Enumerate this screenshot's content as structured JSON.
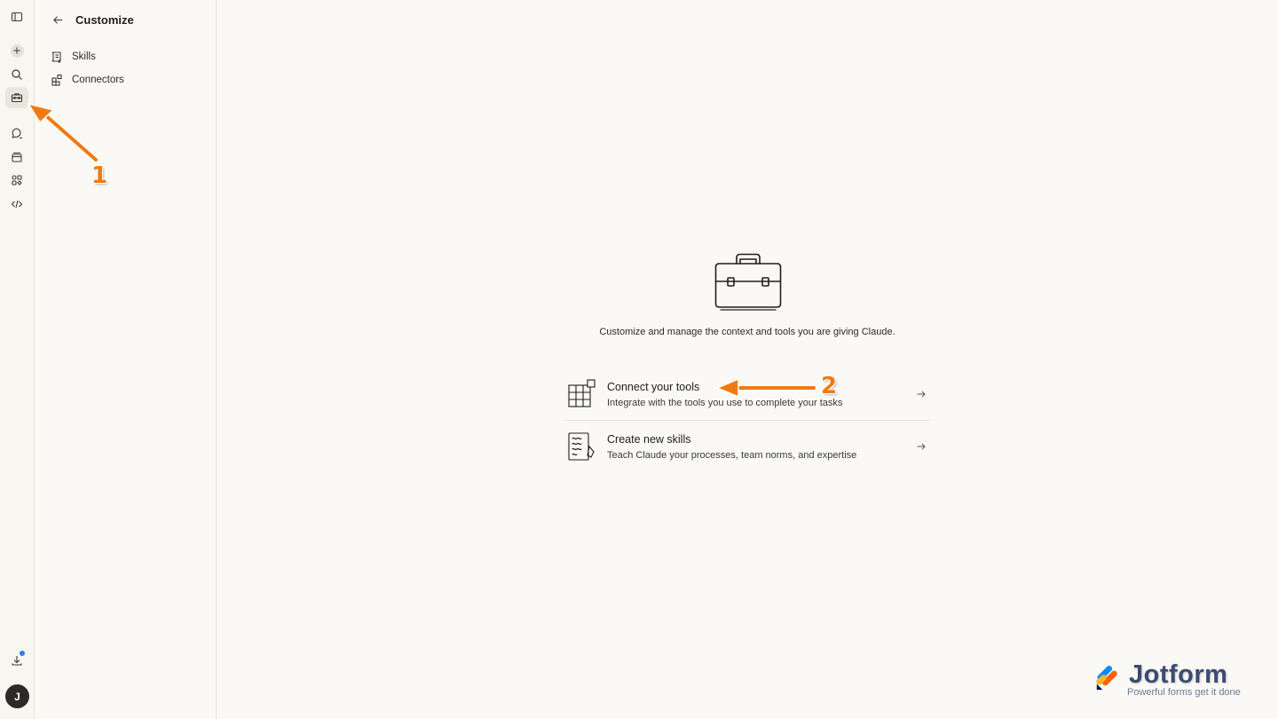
{
  "rail": {
    "items": [
      {
        "name": "sidebar-toggle-icon"
      },
      {
        "name": "new-chat-icon"
      },
      {
        "name": "search-icon"
      },
      {
        "name": "customize-icon"
      },
      {
        "name": "chats-icon"
      },
      {
        "name": "projects-icon"
      },
      {
        "name": "artifacts-icon"
      },
      {
        "name": "code-icon"
      }
    ],
    "avatar_initial": "J"
  },
  "panel": {
    "title": "Customize",
    "items": [
      {
        "label": "Skills",
        "icon": "skills-icon"
      },
      {
        "label": "Connectors",
        "icon": "connectors-icon"
      }
    ]
  },
  "main": {
    "intro": "Customize and manage the context and tools you are giving Claude.",
    "cards": [
      {
        "title": "Connect your tools",
        "description": "Integrate with the tools you use to complete your tasks"
      },
      {
        "title": "Create new skills",
        "description": "Teach Claude your processes, team norms, and expertise"
      }
    ]
  },
  "annotations": {
    "arrow_1_label": "1",
    "arrow_2_label": "2",
    "color": "#f07a12"
  },
  "watermark": {
    "name": "Jotform",
    "tagline": "Powerful forms get it done"
  }
}
